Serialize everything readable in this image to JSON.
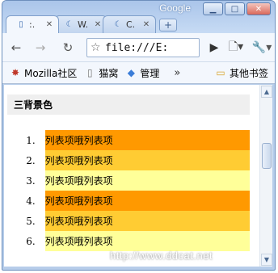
{
  "window": {
    "brand": "Google",
    "controls": {
      "minimize": "▁",
      "maximize": "□",
      "close": "✕"
    }
  },
  "tabs": [
    {
      "label": ":.",
      "icon": "page-icon",
      "close": "✕"
    },
    {
      "label": "W.",
      "icon": "crescent-icon",
      "close": "✕"
    },
    {
      "label": "C.",
      "icon": "crescent-icon",
      "close": "✕"
    }
  ],
  "new_tab": "+",
  "toolbar": {
    "back": "←",
    "forward": "→",
    "reload": "↻",
    "star": "☆",
    "url": "file:///E:",
    "go": "▶",
    "page_menu": "🗋▾",
    "wrench_menu": "🔧▾"
  },
  "bookmarks": {
    "items": [
      {
        "label": "Mozilla社区",
        "icon": "mozilla-icon"
      },
      {
        "label": "猫窝",
        "icon": "page-icon"
      },
      {
        "label": "管理",
        "icon": "bird-icon"
      }
    ],
    "chevron": "»",
    "other": {
      "label": "其他书签",
      "icon": "folder-icon"
    }
  },
  "page": {
    "heading": "三背景色",
    "items": [
      {
        "number": "1.",
        "text": "列表项哦列表项",
        "color": "#ff9900"
      },
      {
        "number": "2.",
        "text": "列表项哦列表项",
        "color": "#ffcc33"
      },
      {
        "number": "3.",
        "text": "列表项哦列表项",
        "color": "#ffff99"
      },
      {
        "number": "4.",
        "text": "列表项哦列表项",
        "color": "#ff9900"
      },
      {
        "number": "5.",
        "text": "列表项哦列表项",
        "color": "#ffcc33"
      },
      {
        "number": "6.",
        "text": "列表项哦列表项",
        "color": "#ffff99"
      }
    ]
  },
  "watermark": "http://www.ddcat.net"
}
